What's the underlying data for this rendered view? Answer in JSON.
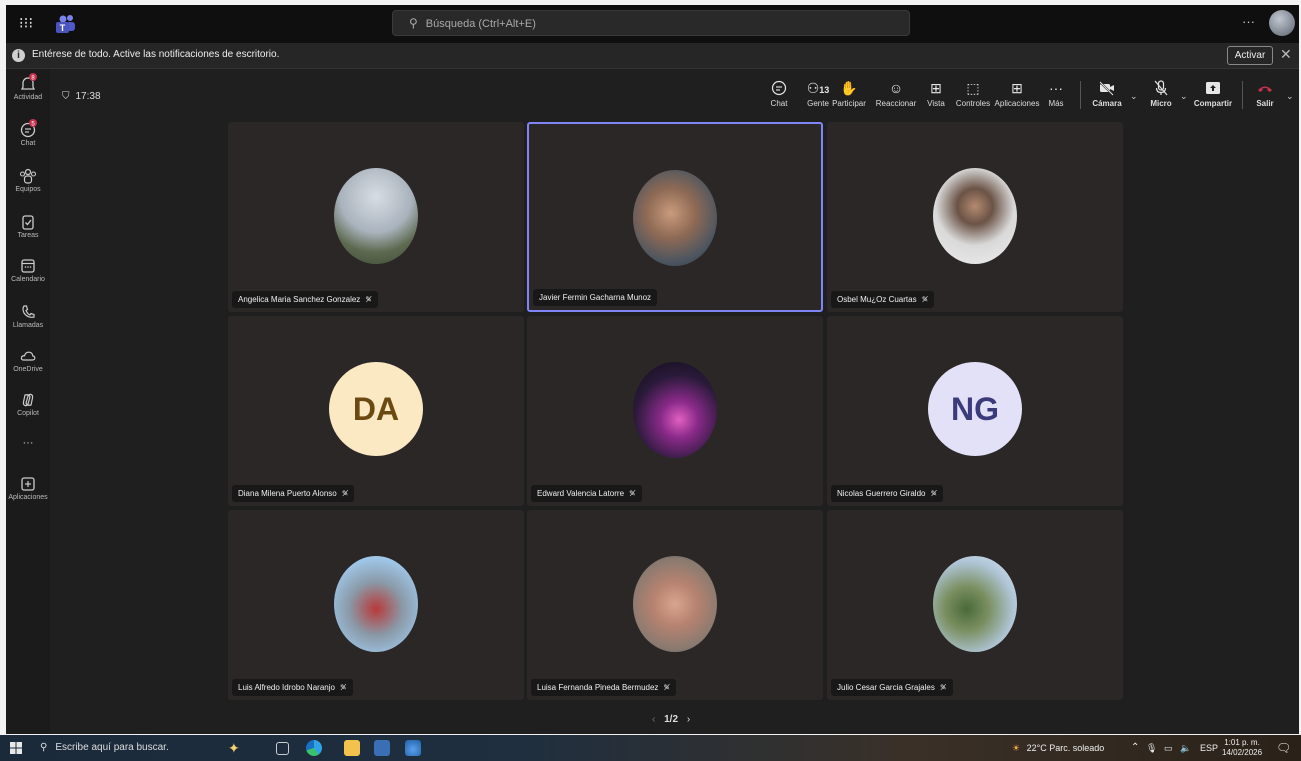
{
  "titlebar": {
    "search_placeholder": "Búsqueda (Ctrl+Alt+E)",
    "more": "···"
  },
  "banner": {
    "message": "Entérese de todo. Active las notificaciones de escritorio.",
    "activate": "Activar",
    "close": "✕"
  },
  "rail": {
    "items": [
      {
        "label": "Actividad",
        "icon": "bell-icon",
        "badge": "8"
      },
      {
        "label": "Chat",
        "icon": "chat-icon",
        "badge": "5"
      },
      {
        "label": "Equipos",
        "icon": "teams-icon"
      },
      {
        "label": "Tareas",
        "icon": "tasks-icon"
      },
      {
        "label": "Calendario",
        "icon": "calendar-icon"
      },
      {
        "label": "Llamadas",
        "icon": "phone-icon"
      },
      {
        "label": "OneDrive",
        "icon": "cloud-icon"
      },
      {
        "label": "Copilot",
        "icon": "copilot-icon"
      },
      {
        "label": "···",
        "icon": "more-icon"
      },
      {
        "label": "Aplicaciones",
        "icon": "apps-icon"
      }
    ]
  },
  "meeting": {
    "timer": "17:38",
    "toolbar": {
      "chat": "Chat",
      "people": "Gente",
      "people_count": "13",
      "raise": "Participar",
      "react": "Reaccionar",
      "view": "Vista",
      "controls": "Controles",
      "apps": "Aplicaciones",
      "more": "Más",
      "camera": "Cámara",
      "mic": "Micro",
      "share": "Compartir",
      "leave": "Salir"
    },
    "participants": [
      {
        "name": "Angelica Maria Sanchez Gonzalez"
      },
      {
        "name": "Javier Fermin Gacharna Munoz"
      },
      {
        "name": "Osbel Mu¿Oz Cuartas"
      },
      {
        "name": "Diana Milena Puerto Alonso",
        "initials": "DA"
      },
      {
        "name": "Edward Valencia Latorre"
      },
      {
        "name": "Nicolas Guerrero Giraldo",
        "initials": "NG"
      },
      {
        "name": "Luis Alfredo Idrobo Naranjo"
      },
      {
        "name": "Luisa Fernanda Pineda Bermudez"
      },
      {
        "name": "Julio Cesar Garcia Grajales"
      }
    ],
    "pager": "1/2"
  },
  "taskbar": {
    "search_placeholder": "Escribe aquí para buscar.",
    "weather": "22°C  Parc. soleado",
    "lang": "ESP",
    "time": "1:01 p. m.",
    "date": "14/02/2026"
  },
  "colors": {
    "accent": "#7f85f5",
    "da_bg": "#fbe9c4",
    "da_fg": "#6b4a12",
    "ng_bg": "#e3e1f7",
    "ng_fg": "#3b3a7a",
    "leave": "#c4314b"
  }
}
